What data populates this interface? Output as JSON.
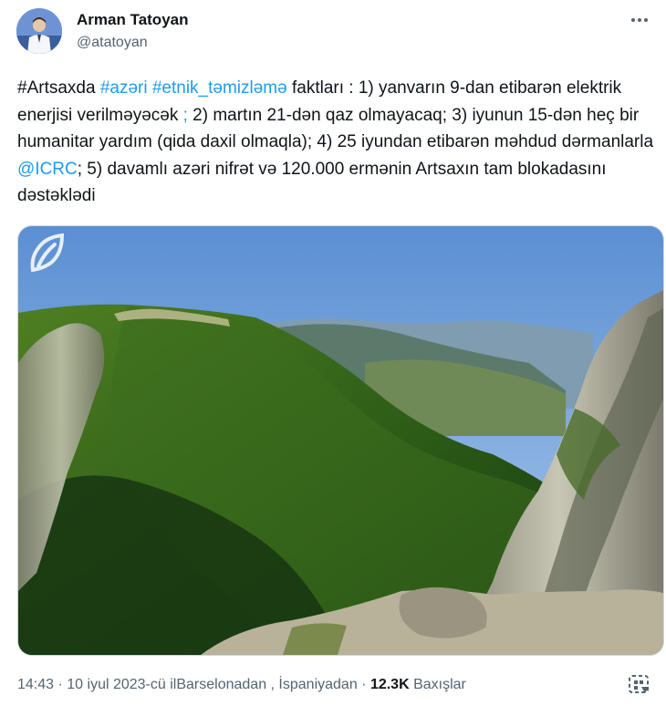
{
  "author": {
    "name": "Arman Tatoyan",
    "handle": "@atatoyan"
  },
  "post": {
    "segments": [
      {
        "text": "#Artsaxda ",
        "link": false
      },
      {
        "text": "#azəri",
        "link": true
      },
      {
        "text": " ",
        "link": false
      },
      {
        "text": "#etnik_təmizləmə",
        "link": true
      },
      {
        "text": " faktları : 1) yanvarın 9-dan etibarən elektrik enerjisi verilməyəcək ",
        "link": false
      },
      {
        "text": ";",
        "link": true
      },
      {
        "text": " 2) martın 21-dən qaz olmayacaq; 3) iyunun 15-dən heç bir humanitar yardım (qida daxil olmaqla); 4) 25 iyundan etibarən məhdud dərmanlarla ",
        "link": false
      },
      {
        "text": "@ICRC",
        "link": true
      },
      {
        "text": "; 5) davamlı azəri nifrət və 120.000 ermənin Artsaxın tam blokadasını dəstəklədi",
        "link": false
      }
    ]
  },
  "meta": {
    "time": "14:43",
    "sep1": " · ",
    "date": "10 iyul 2023-cü il",
    "location": "Barselonadan , İspaniyadan",
    "sep2": " · ",
    "views_count": "12.3K",
    "views_label": " Baxışlar"
  },
  "icons": {
    "more": "more-dots-icon",
    "media_watermark": "leaf-logo-icon",
    "action": "bookmark-grid-icon"
  },
  "colors": {
    "link": "#1d9bf0",
    "secondary_text": "#536471",
    "primary_text": "#0f1419"
  }
}
